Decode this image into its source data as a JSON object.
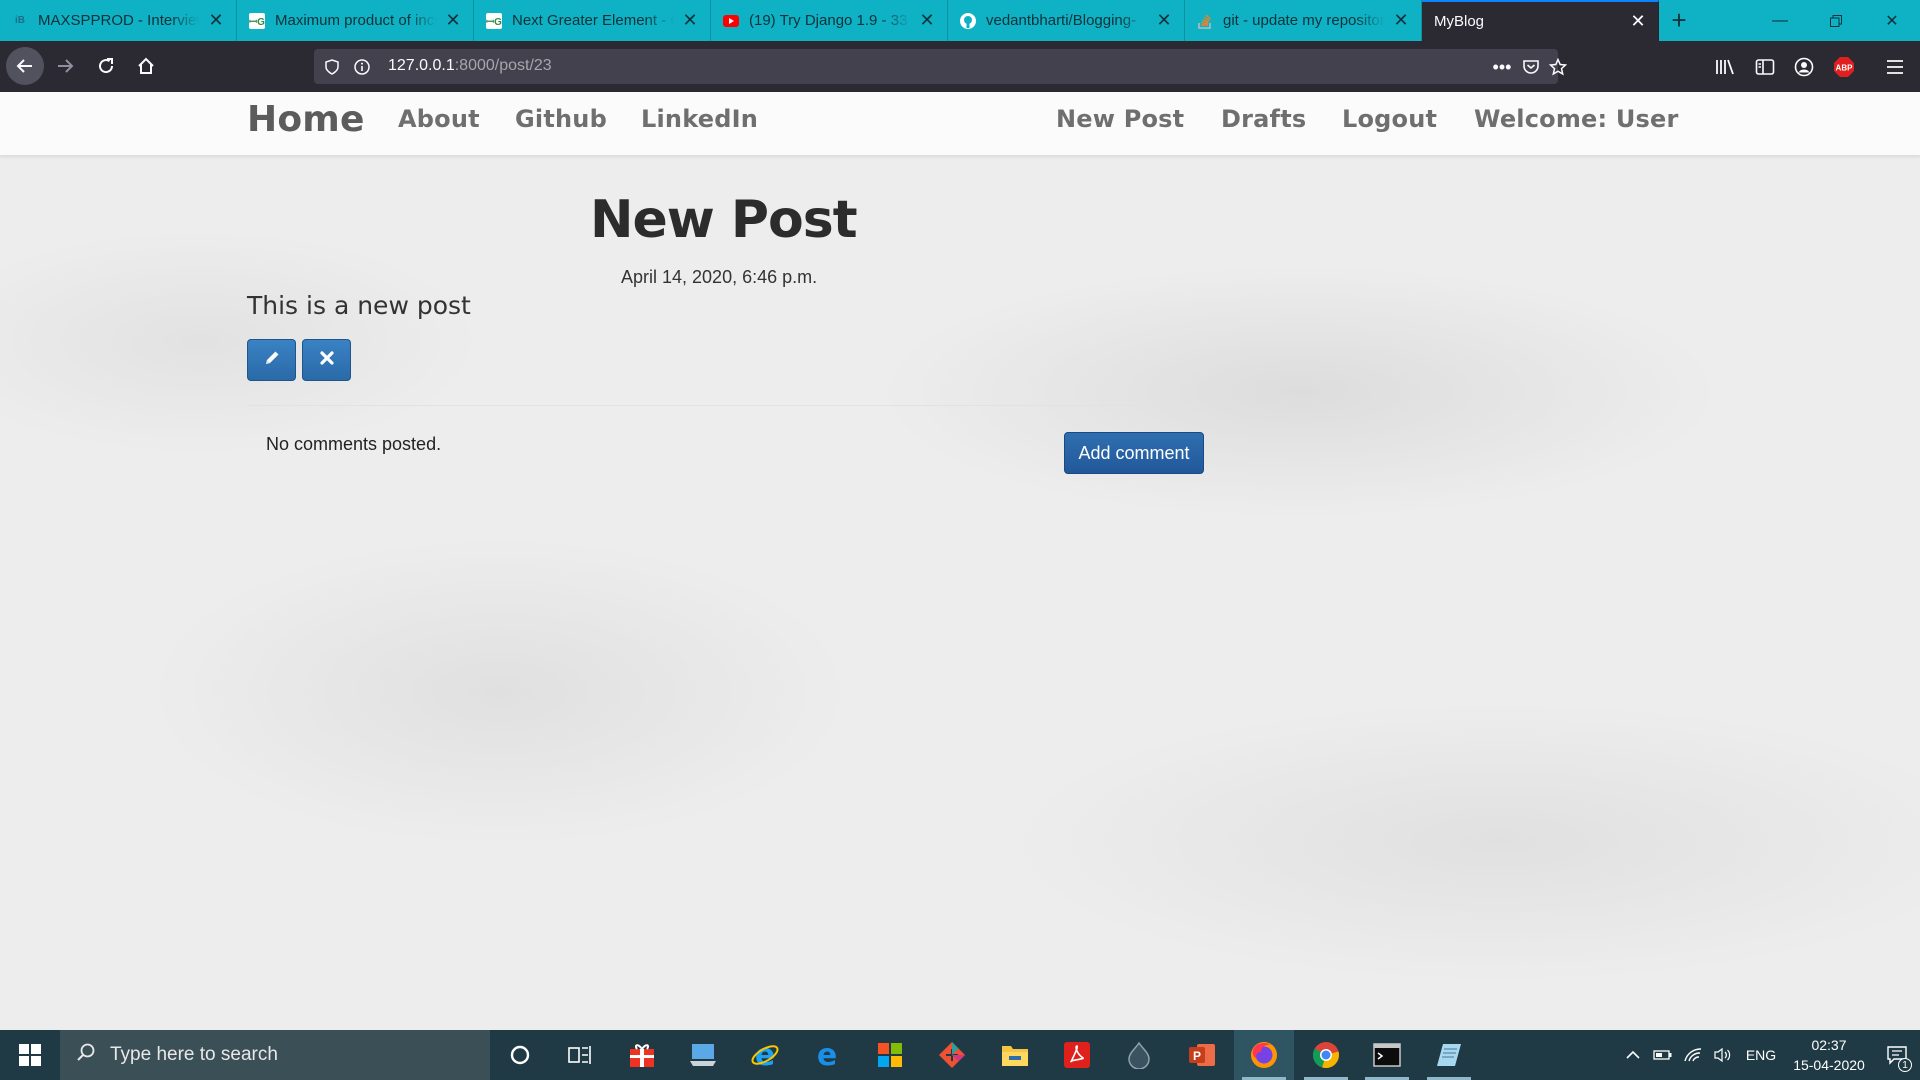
{
  "browser": {
    "tabs": [
      {
        "title": "MAXSPPROD - Interview",
        "icon": "interviewbit-icon",
        "active": false
      },
      {
        "title": "Maximum product of increasing",
        "icon": "geeksforgeeks-icon",
        "active": false
      },
      {
        "title": "Next Greater Element - GeeksforGeeks",
        "icon": "geeksforgeeks-icon",
        "active": false
      },
      {
        "title": "(19) Try Django 1.9 - 33",
        "icon": "youtube-icon",
        "active": false
      },
      {
        "title": "vedantbharti/Blogging-",
        "icon": "github-icon",
        "active": false
      },
      {
        "title": "git - update my repository",
        "icon": "stackoverflow-icon",
        "active": false
      },
      {
        "title": "MyBlog",
        "icon": "",
        "active": true
      }
    ],
    "url": {
      "host": "127.0.0.1",
      "rest": ":8000/post/23"
    },
    "accent": "#0fb2c4"
  },
  "site": {
    "nav_left": {
      "home": "Home",
      "about": "About",
      "github": "Github",
      "linkedin": "LinkedIn"
    },
    "nav_right": {
      "new_post": "New Post",
      "drafts": "Drafts",
      "logout": "Logout",
      "welcome": "Welcome: User"
    },
    "post": {
      "title": "New Post",
      "date": "April 14, 2020, 6:46 p.m.",
      "body": "This is a new post"
    },
    "comments": {
      "empty_text": "No comments posted.",
      "add_label": "Add comment"
    },
    "button_color": "#2a6aa8"
  },
  "taskbar": {
    "search_placeholder": "Type here to search",
    "language": "ENG",
    "time": "02:37",
    "date": "15-04-2020",
    "notification_count": "1"
  }
}
